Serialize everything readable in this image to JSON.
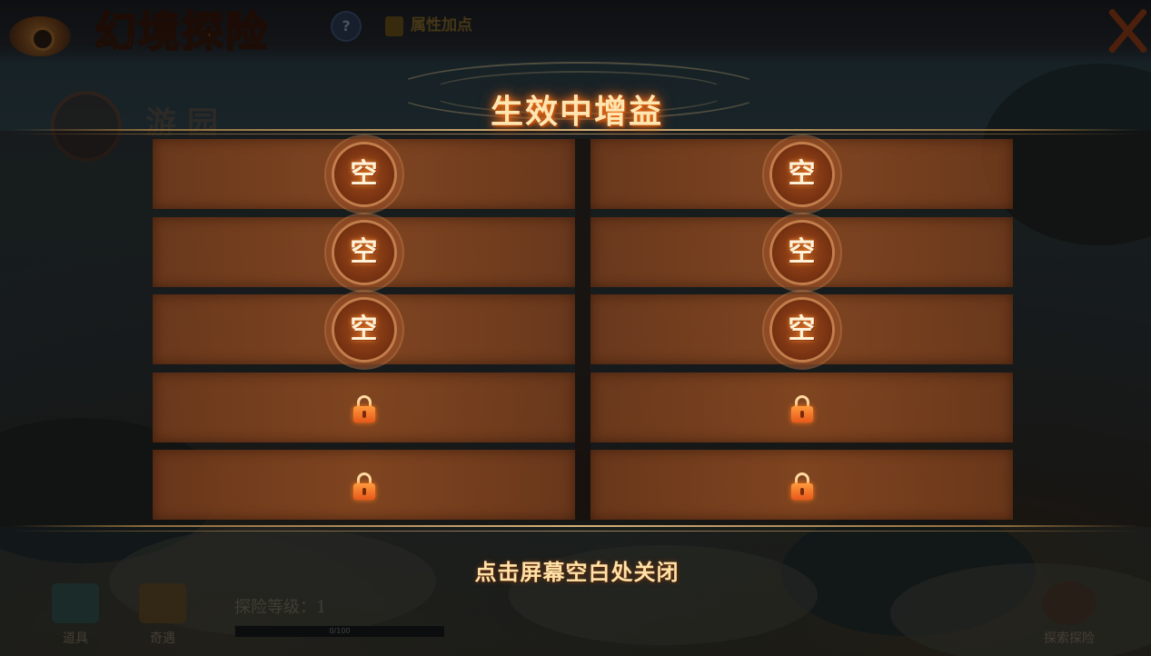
{
  "header": {
    "title": "幻境探险",
    "help_glyph": "?",
    "attribute_button_label": "属性加点",
    "close_glyph": "✕"
  },
  "area": {
    "name": "游园"
  },
  "footer": {
    "scroll_label": "道具",
    "shop_label": "奇遇",
    "level_label": "探险等级：1",
    "level_progress_text": "0/100",
    "level_progress": 0,
    "explore_label": "探索探险"
  },
  "modal": {
    "title": "生效中增益",
    "slots": [
      {
        "state": "empty",
        "label": "空"
      },
      {
        "state": "empty",
        "label": "空"
      },
      {
        "state": "empty",
        "label": "空"
      },
      {
        "state": "empty",
        "label": "空"
      },
      {
        "state": "empty",
        "label": "空"
      },
      {
        "state": "empty",
        "label": "空"
      },
      {
        "state": "locked",
        "icon": "lock-icon"
      },
      {
        "state": "locked",
        "icon": "lock-icon"
      },
      {
        "state": "locked",
        "icon": "lock-icon"
      },
      {
        "state": "locked",
        "icon": "lock-icon"
      }
    ],
    "close_hint": "点击屏幕空白处关闭"
  },
  "colors": {
    "title_glow": "#ff7a1a",
    "slot_fill": "#96502a",
    "gold_rule": "#d3b27a",
    "hint_text": "#ffe2a8"
  }
}
